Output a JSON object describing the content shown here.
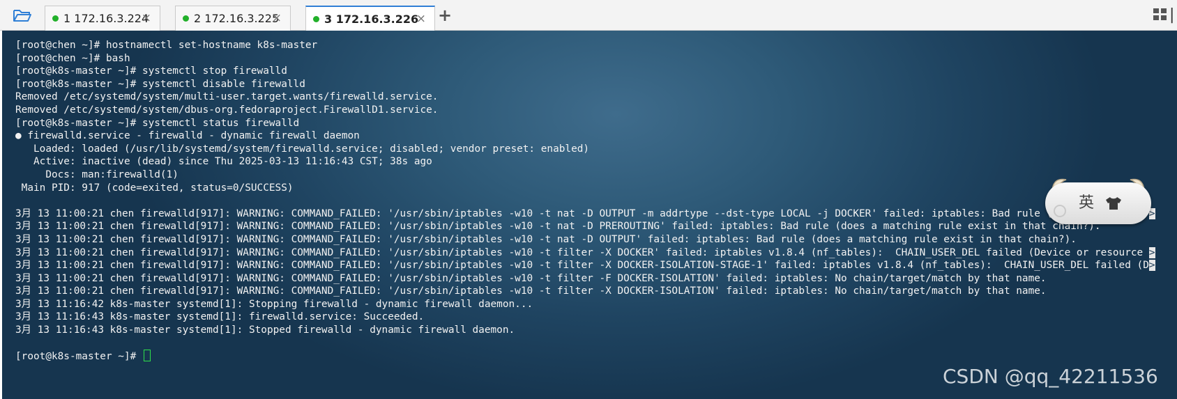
{
  "tabs": [
    {
      "label": "1 172.16.3.224",
      "close": "×",
      "active": false,
      "status_color": "#22b02a"
    },
    {
      "label": "2 172.16.3.225",
      "close": "×",
      "active": false,
      "status_color": "#22b02a"
    },
    {
      "label": "3 172.16.3.226",
      "close": "×",
      "active": true,
      "status_color": "#22b02a"
    }
  ],
  "new_tab": "+",
  "terminal": {
    "lines": [
      {
        "text": "[root@chen ~]# hostnamectl set-hostname k8s-master"
      },
      {
        "text": "[root@chen ~]# bash"
      },
      {
        "text": "[root@k8s-master ~]# systemctl stop firewalld"
      },
      {
        "text": "[root@k8s-master ~]# systemctl disable firewalld"
      },
      {
        "text": "Removed /etc/systemd/system/multi-user.target.wants/firewalld.service."
      },
      {
        "text": "Removed /etc/systemd/system/dbus-org.fedoraproject.FirewallD1.service."
      },
      {
        "text": "[root@k8s-master ~]# systemctl status firewalld"
      },
      {
        "text": "● firewalld.service - firewalld - dynamic firewall daemon"
      },
      {
        "text": "   Loaded: loaded (/usr/lib/systemd/system/firewalld.service; disabled; vendor preset: enabled)"
      },
      {
        "text": "   Active: inactive (dead) since Thu 2025-03-13 11:16:43 CST; 38s ago"
      },
      {
        "text": "     Docs: man:firewalld(1)"
      },
      {
        "text": " Main PID: 917 (code=exited, status=0/SUCCESS)"
      },
      {
        "text": ""
      },
      {
        "text": "3月 13 11:00:21 chen firewalld[917]: WARNING: COMMAND_FAILED: '/usr/sbin/iptables -w10 -t nat -D OUTPUT -m addrtype --dst-type LOCAL -j DOCKER' failed: iptables: Bad rule (does a matching ",
        "trunc": ">"
      },
      {
        "text": "3月 13 11:00:21 chen firewalld[917]: WARNING: COMMAND_FAILED: '/usr/sbin/iptables -w10 -t nat -D PREROUTING' failed: iptables: Bad rule (does a matching rule exist in that chain?)."
      },
      {
        "text": "3月 13 11:00:21 chen firewalld[917]: WARNING: COMMAND_FAILED: '/usr/sbin/iptables -w10 -t nat -D OUTPUT' failed: iptables: Bad rule (does a matching rule exist in that chain?)."
      },
      {
        "text": "3月 13 11:00:21 chen firewalld[917]: WARNING: COMMAND_FAILED: '/usr/sbin/iptables -w10 -t filter -X DOCKER' failed: iptables v1.8.4 (nf_tables):  CHAIN_USER_DEL failed (Device or resource ",
        "trunc": ">"
      },
      {
        "text": "3月 13 11:00:21 chen firewalld[917]: WARNING: COMMAND_FAILED: '/usr/sbin/iptables -w10 -t filter -X DOCKER-ISOLATION-STAGE-1' failed: iptables v1.8.4 (nf_tables):  CHAIN_USER_DEL failed (D",
        "trunc": ">"
      },
      {
        "text": "3月 13 11:00:21 chen firewalld[917]: WARNING: COMMAND_FAILED: '/usr/sbin/iptables -w10 -t filter -F DOCKER-ISOLATION' failed: iptables: No chain/target/match by that name."
      },
      {
        "text": "3月 13 11:00:21 chen firewalld[917]: WARNING: COMMAND_FAILED: '/usr/sbin/iptables -w10 -t filter -X DOCKER-ISOLATION' failed: iptables: No chain/target/match by that name."
      },
      {
        "text": "3月 13 11:16:42 k8s-master systemd[1]: Stopping firewalld - dynamic firewall daemon..."
      },
      {
        "text": "3月 13 11:16:43 k8s-master systemd[1]: firewalld.service: Succeeded."
      },
      {
        "text": "3月 13 11:16:43 k8s-master systemd[1]: Stopped firewalld - dynamic firewall daemon."
      },
      {
        "text": ""
      },
      {
        "text": "[root@k8s-master ~]# ",
        "cursor": true
      }
    ],
    "cursor_color": "#2ee04a"
  },
  "ime": {
    "mode_char": "英",
    "shirt_icon": "shirt-icon"
  },
  "watermark": "CSDN @qq_42211536"
}
